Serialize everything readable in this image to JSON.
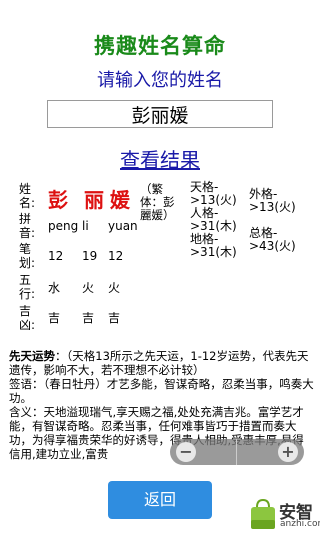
{
  "header": {
    "title": "携趣姓名算命",
    "prompt": "请输入您的姓名"
  },
  "input": {
    "value": "彭丽媛"
  },
  "result_link": "查看结果",
  "analysis": {
    "labels": [
      "姓名:",
      "拼音:",
      "笔划:",
      "五行:",
      "吉凶:"
    ],
    "chars": [
      "彭",
      "丽",
      "媛"
    ],
    "traditional_note": "（繁体：彭麗媛）",
    "pinyin": [
      "peng",
      "li",
      "yuan"
    ],
    "strokes": [
      "12",
      "19",
      "12"
    ],
    "elements": [
      "水",
      "火",
      "火"
    ],
    "fortune": [
      "吉",
      "吉",
      "吉"
    ],
    "grids": {
      "tian": "天格->13(火)",
      "ren": "人格->31(木)",
      "di": "地格->31(木)",
      "wai": "外格->13(火)",
      "zong": "总格->43(火)"
    }
  },
  "luck": {
    "innate_title": "先天运势",
    "innate_text": "：（天格13所示之先天运，1-12岁运势，代表先天遗传，影响不大，若不理想不必计较）",
    "sign_label": "签语：",
    "sign_text": "（春日牡丹）才艺多能，智谋奇略，忍柔当事，鸣奏大功。",
    "meaning_label": "含义：",
    "meaning_text": "天地溢现瑞气,享天赐之福,处处充满吉兆。富学艺才能，有智谋奇略。忍柔当事，任何难事皆巧于措置而奏大功，为得享福贵荣华的好诱导，得贵人相助,受惠丰厚,易得信用,建功立业,富贵"
  },
  "zoom": {
    "minus": "−",
    "plus": "+"
  },
  "back_button": "返回",
  "brand": {
    "name": "安智",
    "url": "anzhi.com"
  }
}
